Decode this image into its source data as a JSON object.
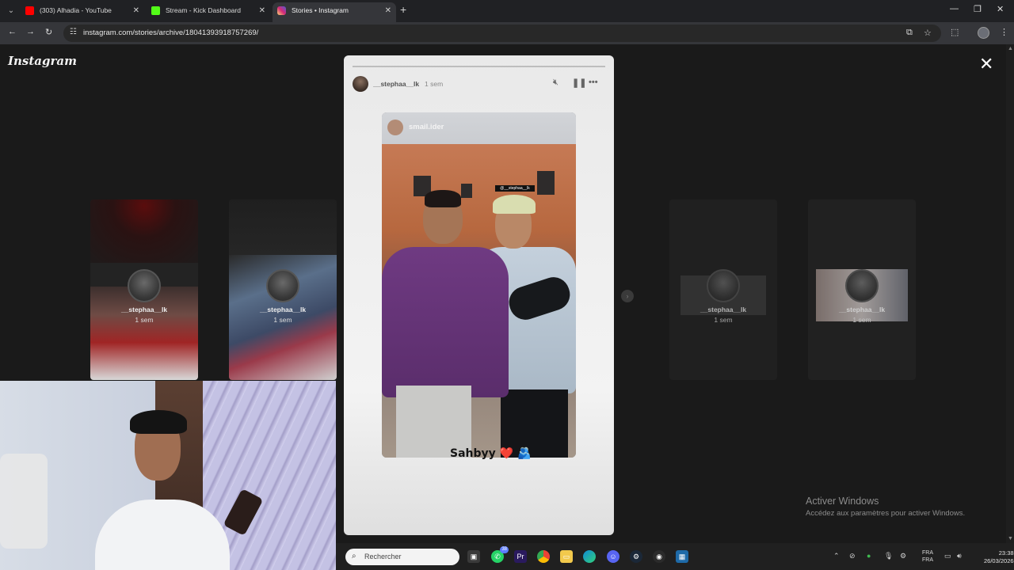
{
  "browser": {
    "tabs": [
      {
        "label": "(303) Alhadia - YouTube",
        "favicon_color": "#ff0000"
      },
      {
        "label": "Stream - Kick Dashboard",
        "favicon_color": "#53fc18"
      },
      {
        "label": "Stories • Instagram",
        "favicon_color": "#d62976"
      }
    ],
    "new_tab": "+",
    "url": "instagram.com/stories/archive/18041393918757269/"
  },
  "page": {
    "logo": "Instagram",
    "close": "✕",
    "next": "›",
    "previews": [
      {
        "user": "__stephaa__lk",
        "time": "1 sem"
      },
      {
        "user": "__stephaa__lk",
        "time": "1 sem"
      },
      {
        "user": "__stephaa__lk",
        "time": "1 sem"
      },
      {
        "user": "__stephaa__lk",
        "time": "1 sem"
      }
    ],
    "story": {
      "user": "__stephaa__lk",
      "time": "1 sem",
      "progress": 0.0,
      "photo_tag": "smail.ider",
      "mention": "@__stephaa__lk",
      "caption": "Sahbyy",
      "caption_heart": "❤️",
      "caption_emoji": "🫂"
    }
  },
  "watermark": {
    "title": "Activer Windows",
    "subtitle": "Accédez aux paramètres pour activer Windows."
  },
  "taskbar": {
    "search_placeholder": "Rechercher",
    "whatsapp_badge": "38",
    "lang_top": "FRA",
    "lang_bottom": "FRA",
    "time": "23:38",
    "date": "26/03/2026"
  },
  "colors": {
    "accent_instagram": "#d62976",
    "page_bg": "#1a1a1a"
  }
}
